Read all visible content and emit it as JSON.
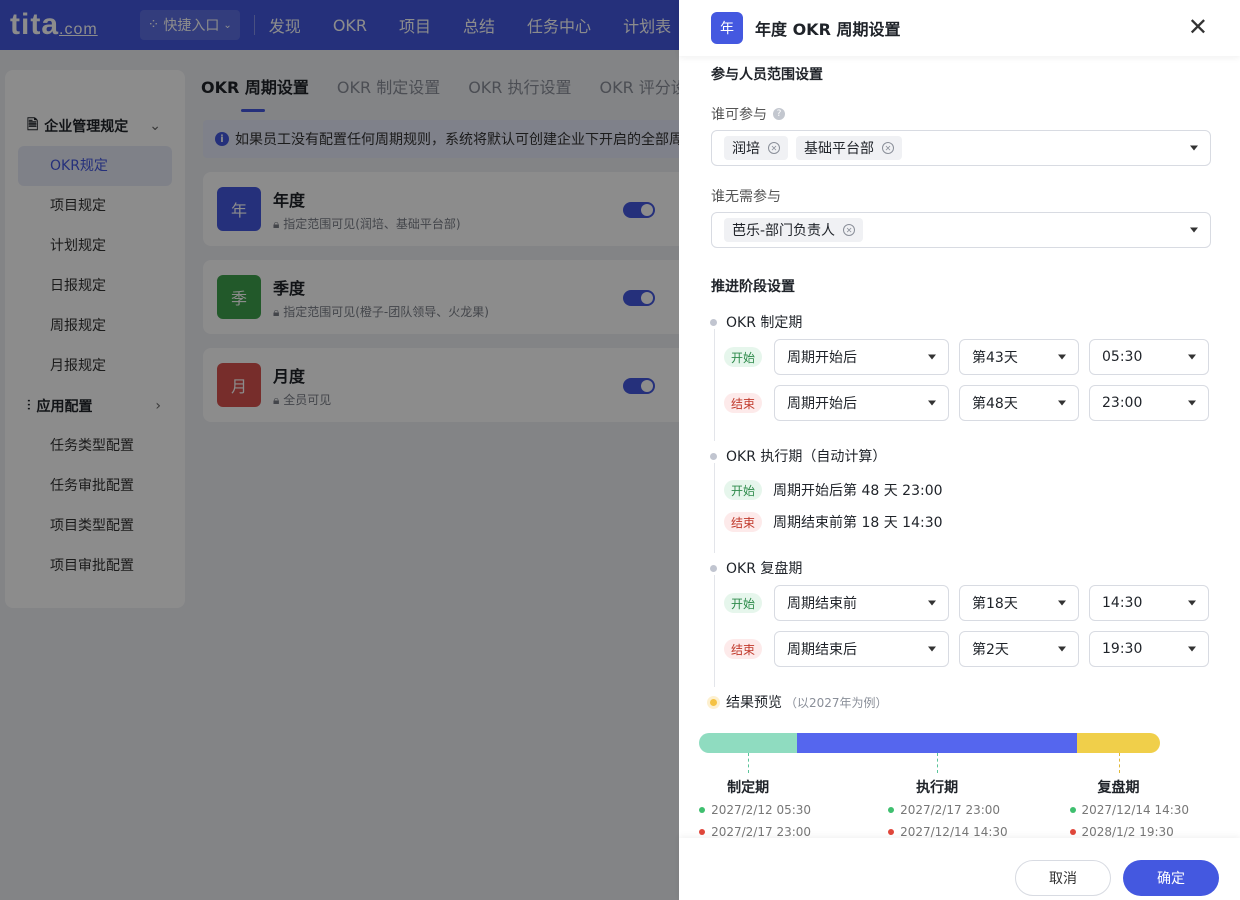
{
  "nav": {
    "logo": "tita",
    "logo_suffix": ".com",
    "quick_entry": "快捷入口",
    "items": [
      "发现",
      "OKR",
      "项目",
      "总结",
      "任务中心",
      "计划表"
    ]
  },
  "sidebar": {
    "group1": "企业管理规定",
    "items1": [
      "OKR规定",
      "项目规定",
      "计划规定",
      "日报规定",
      "周报规定",
      "月报规定"
    ],
    "group2": "应用配置",
    "items2": [
      "任务类型配置",
      "任务审批配置",
      "项目类型配置",
      "项目审批配置"
    ]
  },
  "main": {
    "tabs": [
      "OKR 周期设置",
      "OKR 制定设置",
      "OKR 执行设置",
      "OKR 评分设"
    ],
    "notice": "如果员工没有配置任何周期规则，系统将默认可创建企业下开启的全部周",
    "cards": [
      {
        "badge": "年",
        "title": "年度",
        "sub": "指定范围可见(润培、基础平台部)",
        "color": "#4458e0"
      },
      {
        "badge": "季",
        "title": "季度",
        "sub": "指定范围可见(橙子-团队领导、火龙果)",
        "color": "#3fa34d"
      },
      {
        "badge": "月",
        "title": "月度",
        "sub": "全员可见",
        "color": "#d9534f"
      }
    ]
  },
  "drawer": {
    "badge": "年",
    "title": "年度 OKR 周期设置",
    "scope_title": "参与人员范围设置",
    "who_can_label": "谁可参与",
    "who_can_tags": [
      "润培",
      "基础平台部"
    ],
    "who_not_label": "谁无需参与",
    "who_not_tags": [
      "芭乐-部门负责人"
    ],
    "stage_title": "推进阶段设置",
    "stage1": {
      "name": "OKR 制定期",
      "start": {
        "label": "开始",
        "anchor": "周期开始后",
        "day": "第43天",
        "time": "05:30"
      },
      "end": {
        "label": "结束",
        "anchor": "周期开始后",
        "day": "第48天",
        "time": "23:00"
      }
    },
    "stage2": {
      "name": "OKR 执行期（自动计算）",
      "start_label": "开始",
      "start_text": "周期开始后第 48 天 23:00",
      "end_label": "结束",
      "end_text": "周期结束前第 18 天 14:30"
    },
    "stage3": {
      "name": "OKR 复盘期",
      "start": {
        "label": "开始",
        "anchor": "周期结束前",
        "day": "第18天",
        "time": "14:30"
      },
      "end": {
        "label": "结束",
        "anchor": "周期结束后",
        "day": "第2天",
        "time": "19:30"
      }
    },
    "preview": {
      "title": "结果预览",
      "sub": "（以2027年为例）",
      "phases": [
        {
          "name": "制定期",
          "start": "2027/2/12 05:30",
          "end": "2027/2/17 23:00",
          "fraction": 0.213,
          "color": "#8fdcc0"
        },
        {
          "name": "执行期",
          "start": "2027/2/17 23:00",
          "end": "2027/12/14 14:30",
          "fraction": 0.607,
          "color": "#5566ee"
        },
        {
          "name": "复盘期",
          "start": "2027/12/14 14:30",
          "end": "2028/1/2 19:30",
          "fraction": 0.18,
          "color": "#f0cf4a"
        }
      ]
    },
    "cancel": "取消",
    "confirm": "确定"
  },
  "colors": {
    "accent": "#4458e0",
    "start_dot": "#3fbf6f",
    "end_dot": "#e0463a"
  }
}
